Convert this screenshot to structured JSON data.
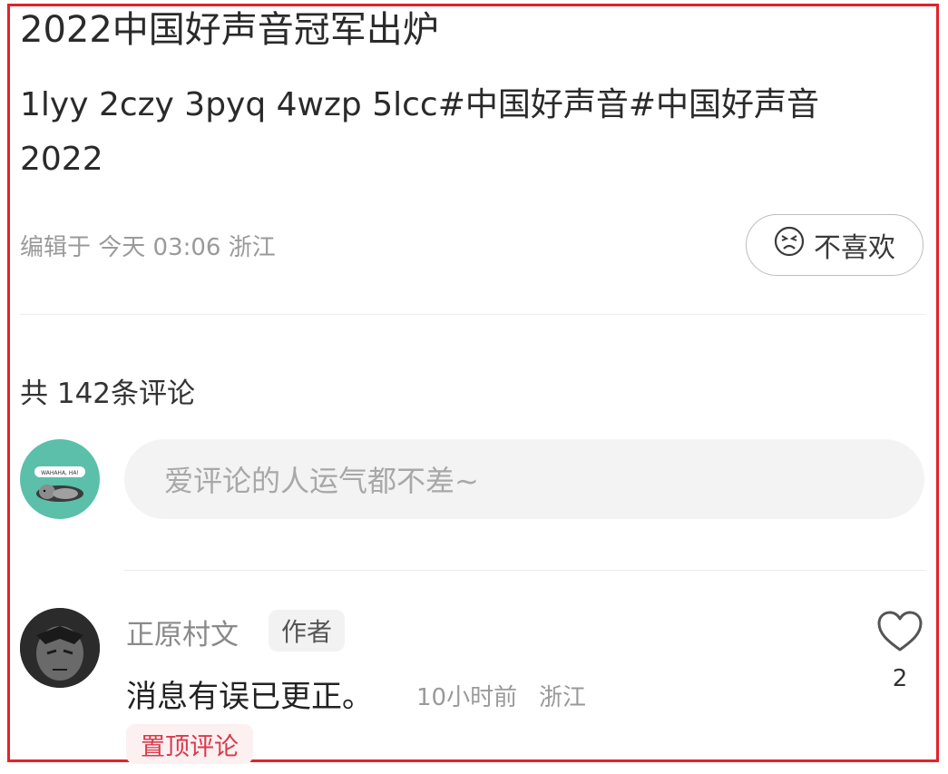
{
  "post": {
    "title": "2022中国好声音冠军出炉",
    "description": "1lyy  2czy 3pyq 4wzp 5lcc#中国好声音#中国好声音2022",
    "meta": "编辑于 今天 03:06 浙江"
  },
  "dislike_button": {
    "label": "不喜欢",
    "icon": "unhappy-face-icon"
  },
  "comments_section": {
    "count_label": "共 142条评论",
    "input_placeholder": "爱评论的人运气都不差~",
    "my_avatar_text": "WAHAHA, HA!",
    "items": [
      {
        "username": "正原村文",
        "tag": "作者",
        "text": "消息有误已更正。",
        "time": "10小时前",
        "location": "浙江",
        "like_count": "2",
        "pinned_label": "置顶评论"
      }
    ]
  },
  "colors": {
    "accent_red": "#e5222a",
    "pinned_text": "#d83a4c",
    "avatar_bg": "#5bbfaa"
  }
}
